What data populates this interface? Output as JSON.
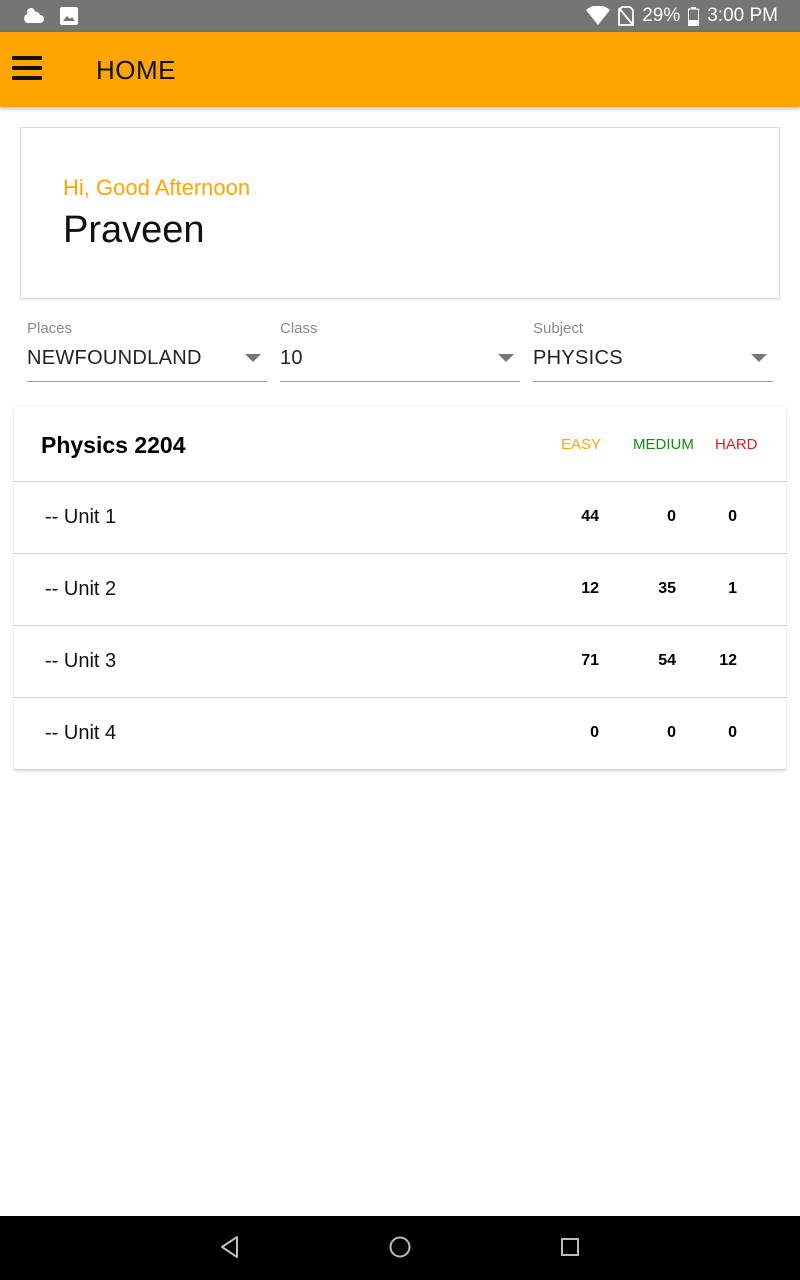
{
  "status_bar": {
    "battery": "29%",
    "time": "3:00 PM"
  },
  "app_bar": {
    "title": "HOME"
  },
  "greeting": {
    "subtitle": "Hi, Good Afternoon",
    "name": "Praveen"
  },
  "filters": {
    "places": {
      "label": "Places",
      "value": "NEWFOUNDLAND"
    },
    "class": {
      "label": "Class",
      "value": "10"
    },
    "subject": {
      "label": "Subject",
      "value": "PHYSICS"
    }
  },
  "subject_table": {
    "title": "Physics 2204",
    "headers": {
      "easy": "EASY",
      "medium": "MEDIUM",
      "hard": "HARD"
    },
    "rows": [
      {
        "label": "-- Unit 1",
        "easy": "44",
        "medium": "0",
        "hard": "0"
      },
      {
        "label": "-- Unit 2",
        "easy": "12",
        "medium": "35",
        "hard": "1"
      },
      {
        "label": "-- Unit 3",
        "easy": "71",
        "medium": "54",
        "hard": "12"
      },
      {
        "label": "-- Unit 4",
        "easy": "0",
        "medium": "0",
        "hard": "0"
      }
    ]
  },
  "colors": {
    "accent": "#ffa500",
    "easy": "#ffa500",
    "medium": "#138a13",
    "hard": "#e31b1b"
  },
  "icons": [
    "weather-icon",
    "image-notification-icon",
    "wifi-icon",
    "no-sim-icon",
    "battery-icon",
    "menu-icon",
    "back-icon",
    "home-icon",
    "recents-icon"
  ]
}
